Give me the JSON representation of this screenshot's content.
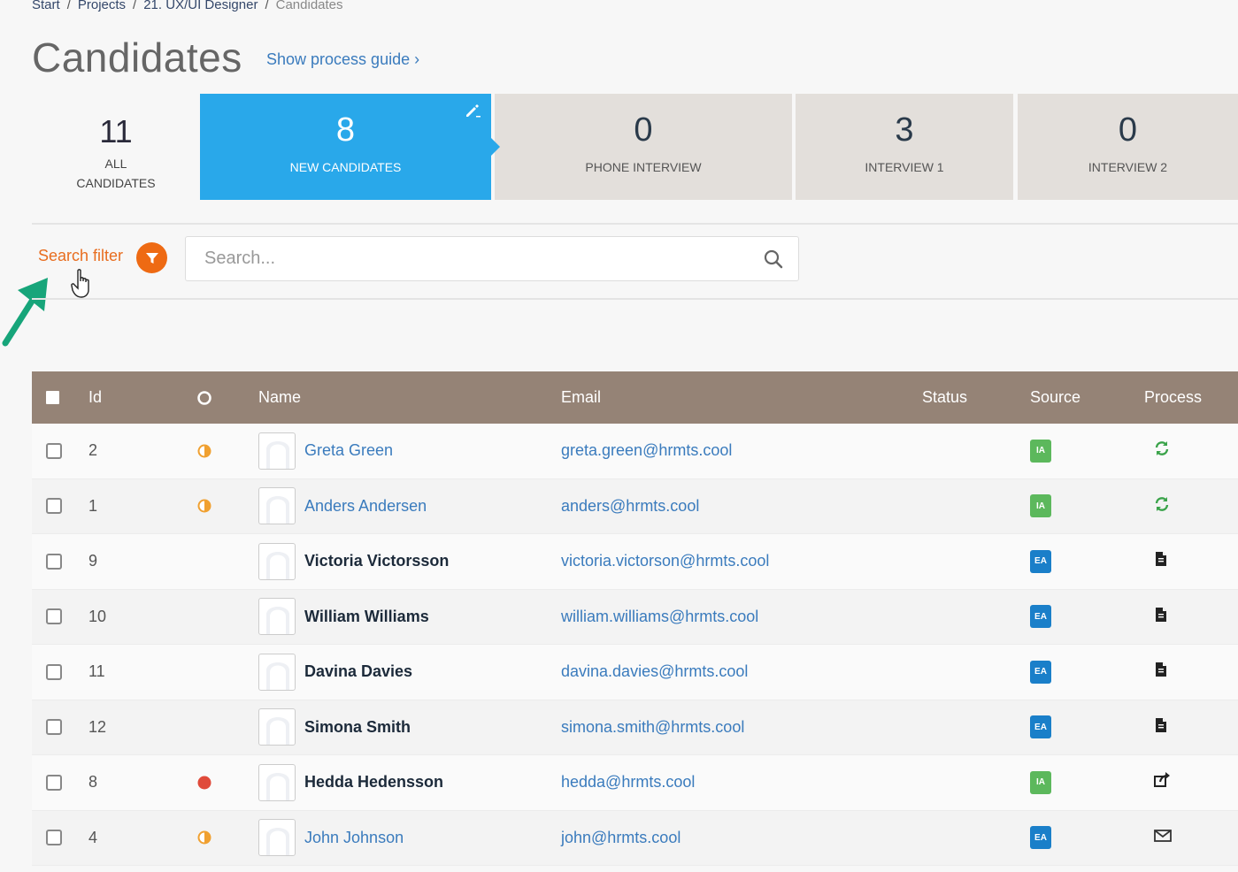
{
  "breadcrumb": [
    "Start",
    "Projects",
    "21. UX/UI Designer",
    "Candidates"
  ],
  "page_title": "Candidates",
  "guide_link": "Show process guide ›",
  "pipeline": {
    "all": {
      "count": "11",
      "label_line1": "ALL",
      "label_line2": "CANDIDATES"
    },
    "stages": [
      {
        "count": "8",
        "label": "NEW CANDIDATES",
        "active": true
      },
      {
        "count": "0",
        "label": "PHONE INTERVIEW",
        "active": false
      },
      {
        "count": "3",
        "label": "INTERVIEW 1",
        "active": false
      },
      {
        "count": "0",
        "label": "INTERVIEW 2",
        "active": false
      }
    ]
  },
  "search": {
    "filter_label": "Search filter",
    "placeholder": "Search..."
  },
  "table": {
    "headers": {
      "id": "Id",
      "name": "Name",
      "email": "Email",
      "status": "Status",
      "source": "Source",
      "process": "Process"
    },
    "rows": [
      {
        "id": "2",
        "dot": "half-orange",
        "name": "Greta Green",
        "bold": false,
        "email": "greta.green@hrmts.cool",
        "source": "IA",
        "process": "refresh-icon"
      },
      {
        "id": "1",
        "dot": "half-orange",
        "name": "Anders Andersen",
        "bold": false,
        "email": "anders@hrmts.cool",
        "source": "IA",
        "process": "refresh-icon"
      },
      {
        "id": "9",
        "dot": "",
        "name": "Victoria Victorsson",
        "bold": true,
        "email": "victoria.victorson@hrmts.cool",
        "source": "EA",
        "process": "document-icon"
      },
      {
        "id": "10",
        "dot": "",
        "name": "William Williams",
        "bold": true,
        "email": "william.williams@hrmts.cool",
        "source": "EA",
        "process": "document-icon"
      },
      {
        "id": "11",
        "dot": "",
        "name": "Davina Davies",
        "bold": true,
        "email": "davina.davies@hrmts.cool",
        "source": "EA",
        "process": "document-icon"
      },
      {
        "id": "12",
        "dot": "",
        "name": "Simona Smith",
        "bold": true,
        "email": "simona.smith@hrmts.cool",
        "source": "EA",
        "process": "document-icon"
      },
      {
        "id": "8",
        "dot": "red",
        "name": "Hedda Hedensson",
        "bold": true,
        "email": "hedda@hrmts.cool",
        "source": "IA",
        "process": "share-icon"
      },
      {
        "id": "4",
        "dot": "half-orange",
        "name": "John Johnson",
        "bold": false,
        "email": "john@hrmts.cool",
        "source": "EA",
        "process": "envelope-icon"
      }
    ]
  },
  "colors": {
    "active_stage": "#29a8ea",
    "header_bg": "#958376",
    "filter_orange": "#ee6a13",
    "source_ia": "#5cb85c",
    "source_ea": "#1a7fc9",
    "annotation_arrow": "#17a57a"
  }
}
